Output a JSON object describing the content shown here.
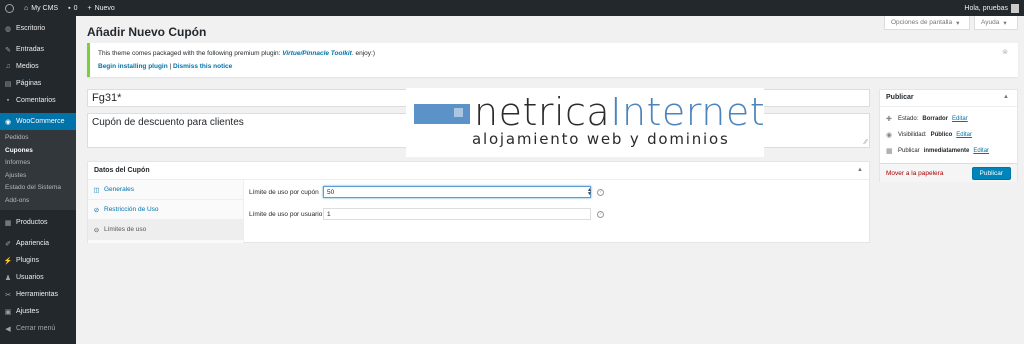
{
  "adminbar": {
    "site_name": "My CMS",
    "comments_count": "0",
    "new_label": "Nuevo",
    "greeting": "Hola, pruebas"
  },
  "sidebar": {
    "items": [
      {
        "label": "Escritorio",
        "icon": "dashboard-icon"
      },
      {
        "label": "Entradas",
        "icon": "pin-icon"
      },
      {
        "label": "Medios",
        "icon": "media-icon"
      },
      {
        "label": "Páginas",
        "icon": "page-icon"
      },
      {
        "label": "Comentarios",
        "icon": "comment-icon"
      },
      {
        "label": "WooCommerce",
        "icon": "woo-icon"
      }
    ],
    "submenu": [
      "Pedidos",
      "Cupones",
      "Informes",
      "Ajustes",
      "Estado del Sistema",
      "Add-ons"
    ],
    "items_after": [
      {
        "label": "Productos",
        "icon": "products-icon"
      },
      {
        "label": "Apariencia",
        "icon": "appearance-icon"
      },
      {
        "label": "Plugins",
        "icon": "plugins-icon"
      },
      {
        "label": "Usuarios",
        "icon": "users-icon"
      },
      {
        "label": "Herramientas",
        "icon": "tools-icon"
      },
      {
        "label": "Ajustes",
        "icon": "settings-icon"
      }
    ],
    "collapse_label": "Cerrar menú"
  },
  "screen_options": "Opciones de pantalla",
  "help_label": "Ayuda",
  "page_title": "Añadir Nuevo Cupón",
  "notice": {
    "text_before": "This theme comes packaged with the following premium plugin: ",
    "plugin_name": "Virtue/Pinnacle Toolkit",
    "text_after": ". enjoy:)",
    "install_link": "Begin installing plugin",
    "separator": "|",
    "dismiss_link": "Dismiss this notice"
  },
  "coupon_code": "Fg31*",
  "coupon_description": "Cupón de descuento para clientes",
  "coupon_data": {
    "title": "Datos del Cupón",
    "tabs": [
      "Generales",
      "Restricción de Uso",
      "Límites de uso"
    ],
    "fields": [
      {
        "label": "Límite de uso por cupón",
        "value": "50"
      },
      {
        "label": "Límite de uso por usuario",
        "value": "1"
      }
    ]
  },
  "publish": {
    "title": "Publicar",
    "status_label": "Estado:",
    "status_value": "Borrador",
    "visibility_label": "Visibilidad:",
    "visibility_value": "Público",
    "publish_label": "Publicar",
    "publish_value": "inmediatamente",
    "edit_link": "Editar",
    "trash_link": "Mover a la papelera",
    "publish_button": "Publicar"
  },
  "logo": {
    "word1": "netrica",
    "word2": "Internet",
    "tagline": "alojamiento web y dominios"
  },
  "colors": {
    "accent": "#0073aa",
    "adminbar": "#23282d",
    "notice_border": "#7ad03a",
    "trash": "#aa0000"
  }
}
